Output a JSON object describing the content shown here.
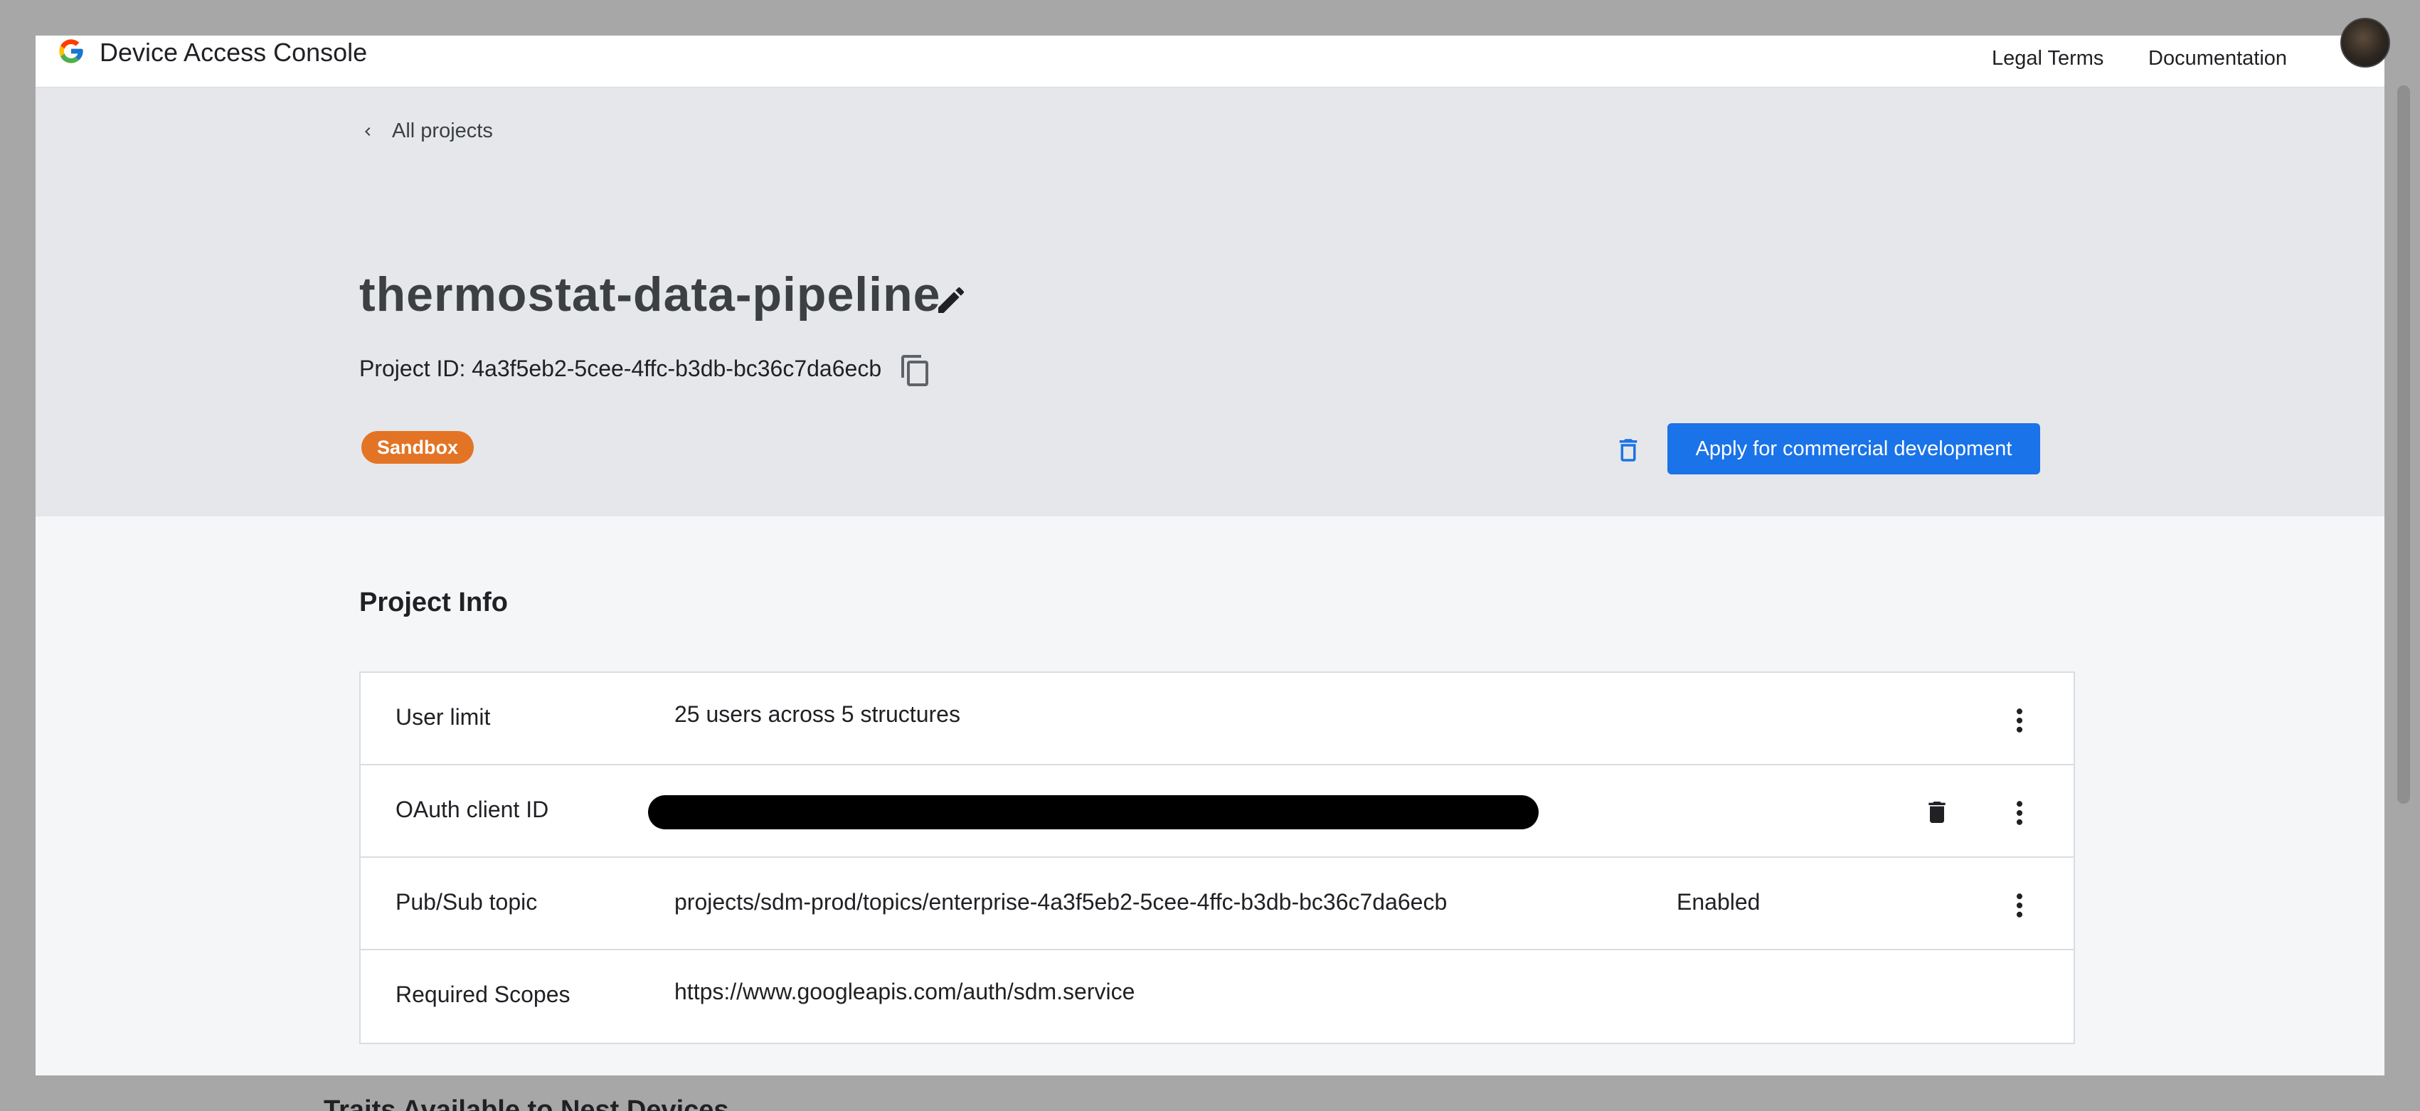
{
  "app": {
    "title": "Device Access Console"
  },
  "nav": {
    "legal": "Legal Terms",
    "docs": "Documentation"
  },
  "breadcrumb": {
    "back_label": "All projects"
  },
  "project": {
    "name": "thermostat-data-pipeline",
    "id_label": "Project ID: 4a3f5eb2-5cee-4ffc-b3db-bc36c7da6ecb",
    "badge": "Sandbox",
    "apply_label": "Apply for commercial development"
  },
  "info": {
    "title": "Project Info",
    "rows": [
      {
        "label": "User limit",
        "value": "25 users across 5 structures",
        "status": ""
      },
      {
        "label": "OAuth client ID",
        "value": "",
        "status": ""
      },
      {
        "label": "Pub/Sub topic",
        "value": "projects/sdm-prod/topics/enterprise-4a3f5eb2-5cee-4ffc-b3db-bc36c7da6ecb",
        "status": "Enabled"
      },
      {
        "label": "Required Scopes",
        "value": "https://www.googleapis.com/auth/sdm.service",
        "status": ""
      }
    ]
  },
  "next_section": {
    "title": "Traits Available to Nest Devices"
  },
  "colors": {
    "accent": "#1a73e8",
    "badge": "#e37425",
    "header_bg": "#e6e7ea"
  },
  "icons": [
    "google-logo-icon",
    "chevron-left-icon",
    "pencil-icon",
    "copy-icon",
    "trash-icon",
    "kebab-menu-icon"
  ]
}
